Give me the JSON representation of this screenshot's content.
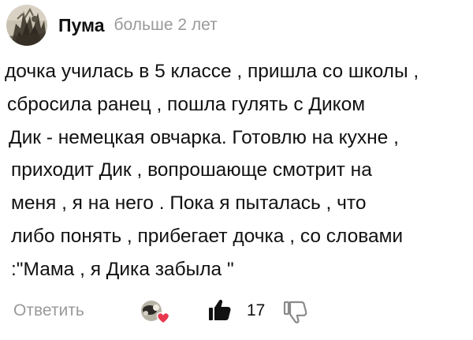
{
  "comment": {
    "author": "Пума",
    "time": "больше 2 лет",
    "avatar_icon": "avatar-image",
    "text_lines": [
      "дочка училась в 5 классе , пришла со школы ,",
      "сбросила ранец , пошла гулять с Диком",
      "Дик - немецкая овчарка. Готовлю на кухне ,",
      "приходит Дик , вопрошающе смотрит на",
      "меня , я на него . Пока я пыталась , что",
      "либо понять , прибегает дочка , со словами",
      ":\"Мама , я Дика забыла \""
    ]
  },
  "footer": {
    "reply_label": "Ответить",
    "reaction_icon": "reaction-avatar-heart-icon",
    "like_icon": "thumbs-up-icon",
    "like_count": "17",
    "dislike_icon": "thumbs-down-icon"
  },
  "colors": {
    "text": "#111111",
    "muted": "#9a9a9a",
    "heart": "#e8384f"
  }
}
